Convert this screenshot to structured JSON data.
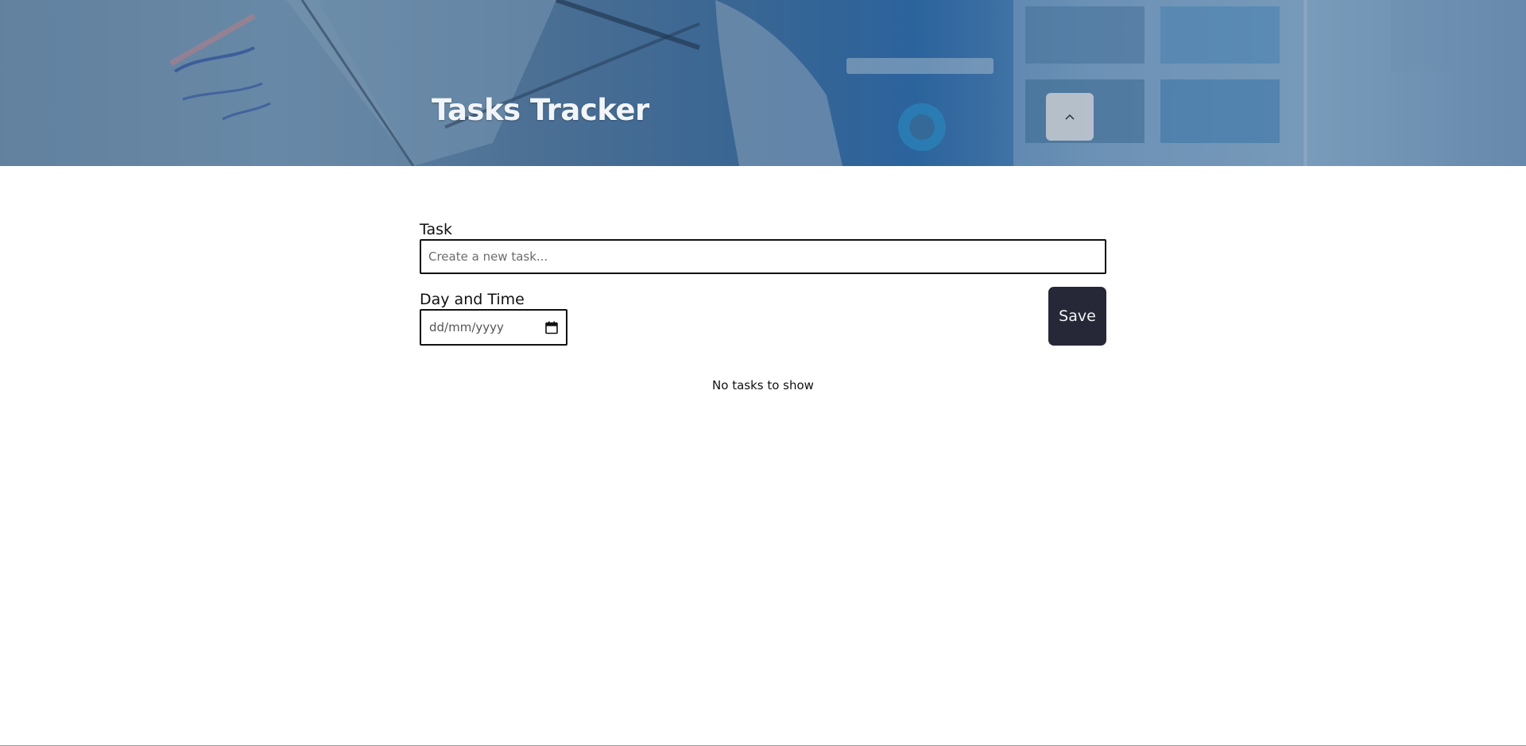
{
  "header": {
    "title": "Tasks Tracker",
    "toggle_icon": "chevron-up-icon"
  },
  "form": {
    "task_label": "Task",
    "task_placeholder": "Create a new task...",
    "task_value": "",
    "datetime_label": "Day and Time",
    "datetime_placeholder": "dd/mm/yyyy",
    "calendar_icon": "calendar-icon",
    "save_label": "Save"
  },
  "tasks": {
    "empty_message": "No tasks to show"
  },
  "colors": {
    "save_button_bg": "#262838",
    "header_text": "#f2f5f8",
    "toggle_button_bg": "#c4c8d0",
    "border": "#111111"
  }
}
